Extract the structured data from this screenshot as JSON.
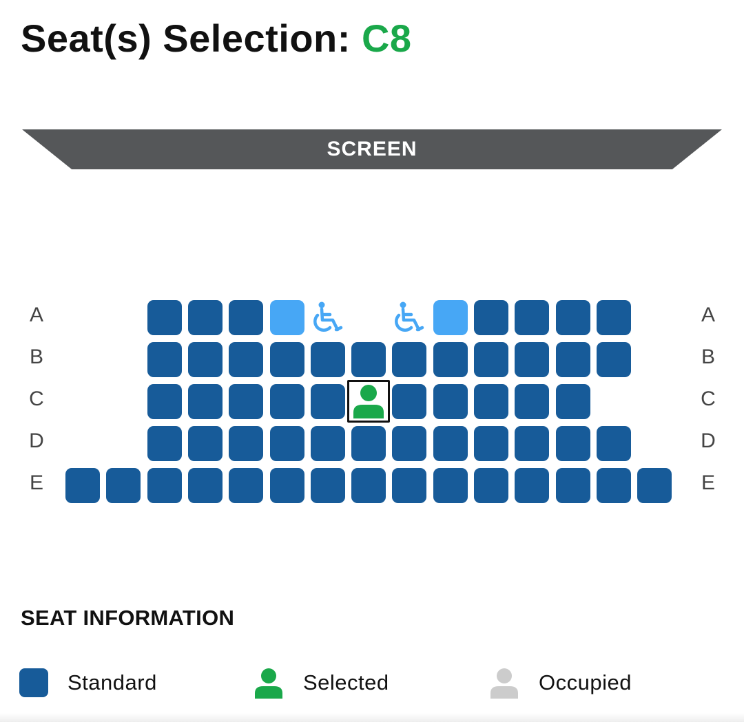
{
  "header": {
    "title_prefix": "Seat(s) Selection: ",
    "selected_seats": "C8"
  },
  "screen_label": "SCREEN",
  "rows": [
    {
      "label": "A",
      "seats": [
        "",
        "",
        "standard",
        "standard",
        "standard",
        "light",
        "wheelchair",
        "",
        "wheelchair",
        "light",
        "standard",
        "standard",
        "standard",
        "standard",
        ""
      ]
    },
    {
      "label": "B",
      "seats": [
        "",
        "",
        "standard",
        "standard",
        "standard",
        "standard",
        "standard",
        "standard",
        "standard",
        "standard",
        "standard",
        "standard",
        "standard",
        "standard",
        ""
      ]
    },
    {
      "label": "C",
      "seats": [
        "",
        "",
        "standard",
        "standard",
        "standard",
        "standard",
        "standard",
        "selected",
        "standard",
        "standard",
        "standard",
        "standard",
        "standard",
        "",
        ""
      ]
    },
    {
      "label": "D",
      "seats": [
        "",
        "",
        "standard",
        "standard",
        "standard",
        "standard",
        "standard",
        "standard",
        "standard",
        "standard",
        "standard",
        "standard",
        "standard",
        "standard",
        ""
      ]
    },
    {
      "label": "E",
      "seats": [
        "standard",
        "standard",
        "standard",
        "standard",
        "standard",
        "standard",
        "standard",
        "standard",
        "standard",
        "standard",
        "standard",
        "standard",
        "standard",
        "standard",
        "standard"
      ]
    }
  ],
  "seat_info": {
    "title": "SEAT INFORMATION",
    "legend": [
      {
        "key": "standard",
        "label": "Standard"
      },
      {
        "key": "selected",
        "label": "Selected"
      },
      {
        "key": "occupied",
        "label": "Occupied"
      }
    ]
  },
  "colors": {
    "standard": "#175b99",
    "light": "#47a7f5",
    "selected": "#1aa84a",
    "occupied": "#cccccc",
    "wheelchair": "#47a7f5",
    "screen": "#555759"
  }
}
